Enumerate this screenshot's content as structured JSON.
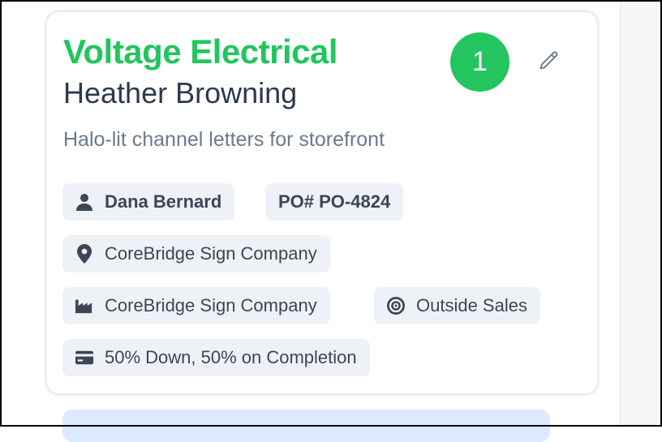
{
  "card": {
    "company_name": "Voltage Electrical",
    "contact_name": "Heather Browning",
    "description": "Halo-lit channel letters for storefront",
    "count_badge": "1",
    "edit_icon": "pencil-icon"
  },
  "chips": {
    "salesperson": {
      "label": "Dana Bernard",
      "icon": "user-icon"
    },
    "po": {
      "label": "PO# PO-4824"
    },
    "location": {
      "label": "CoreBridge Sign Company",
      "icon": "map-pin-icon"
    },
    "company": {
      "label": "CoreBridge Sign Company",
      "icon": "factory-icon"
    },
    "origin": {
      "label": "Outside Sales",
      "icon": "target-icon"
    },
    "payment_terms": {
      "label": "50% Down, 50% on Completion",
      "icon": "credit-card-icon"
    }
  },
  "colors": {
    "accent_green": "#22c55e",
    "chip_bg": "#eef1f6",
    "card_border": "#e7eef8",
    "next_panel": "#dbeafe"
  }
}
